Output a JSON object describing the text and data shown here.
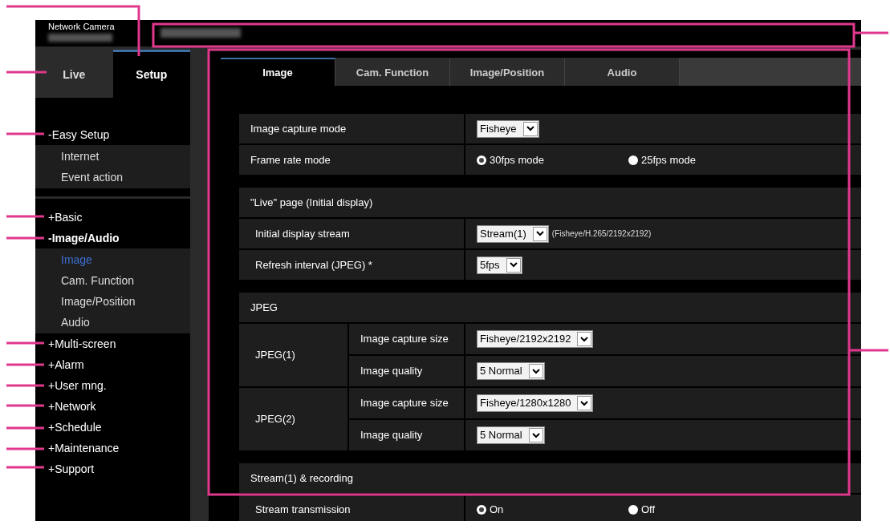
{
  "header": {
    "product": "Network Camera"
  },
  "mode_tabs": [
    {
      "label": "Live",
      "selected": false
    },
    {
      "label": "Setup",
      "selected": true
    }
  ],
  "menu_groups": [
    {
      "items": [
        {
          "label": "-Easy Setup",
          "selected": false,
          "children": [
            {
              "label": "Internet",
              "selected": false
            },
            {
              "label": "Event action",
              "selected": false
            }
          ]
        }
      ]
    },
    {
      "items": [
        {
          "label": "+Basic",
          "selected": false
        },
        {
          "label": "-Image/Audio",
          "selected": true,
          "children": [
            {
              "label": "Image",
              "selected": true
            },
            {
              "label": "Cam. Function",
              "selected": false
            },
            {
              "label": "Image/Position",
              "selected": false
            },
            {
              "label": "Audio",
              "selected": false
            }
          ]
        },
        {
          "label": "+Multi-screen",
          "selected": false
        },
        {
          "label": "+Alarm",
          "selected": false
        },
        {
          "label": "+User mng.",
          "selected": false
        },
        {
          "label": "+Network",
          "selected": false
        },
        {
          "label": "+Schedule",
          "selected": false
        },
        {
          "label": "+Maintenance",
          "selected": false
        },
        {
          "label": "+Support",
          "selected": false
        }
      ]
    }
  ],
  "tabs": [
    {
      "label": "Image",
      "selected": true
    },
    {
      "label": "Cam. Function",
      "selected": false
    },
    {
      "label": "Image/Position",
      "selected": false
    },
    {
      "label": "Audio",
      "selected": false
    }
  ],
  "sections": [
    {
      "rows": [
        {
          "kind": "select",
          "label": "Image capture mode",
          "value": "Fisheye"
        },
        {
          "kind": "radios",
          "label": "Frame rate mode",
          "options": [
            {
              "label": "30fps mode",
              "selected": true
            },
            {
              "label": "25fps mode",
              "selected": false
            }
          ]
        }
      ]
    },
    {
      "title": "\"Live\" page (Initial display)",
      "rows": [
        {
          "kind": "select",
          "label": "Initial display stream",
          "value": "Stream(1)",
          "note": "(Fisheye/H.265/2192x2192)"
        },
        {
          "kind": "select",
          "label": "Refresh interval (JPEG) *",
          "value": "5fps"
        }
      ]
    },
    {
      "title": "JPEG",
      "rows": [
        {
          "kind": "group",
          "label": "JPEG(1)",
          "rows": [
            {
              "kind": "select",
              "label": "Image capture size",
              "value": "Fisheye/2192x2192"
            },
            {
              "kind": "select",
              "label": "Image quality",
              "value": "5 Normal"
            }
          ]
        },
        {
          "kind": "group",
          "label": "JPEG(2)",
          "rows": [
            {
              "kind": "select",
              "label": "Image capture size",
              "value": "Fisheye/1280x1280"
            },
            {
              "kind": "select",
              "label": "Image quality",
              "value": "5 Normal"
            }
          ]
        }
      ]
    },
    {
      "title": "Stream(1) & recording",
      "rows": [
        {
          "kind": "radios",
          "label": "Stream transmission",
          "options": [
            {
              "label": "On",
              "selected": true
            },
            {
              "label": "Off",
              "selected": false
            }
          ]
        }
      ]
    }
  ]
}
